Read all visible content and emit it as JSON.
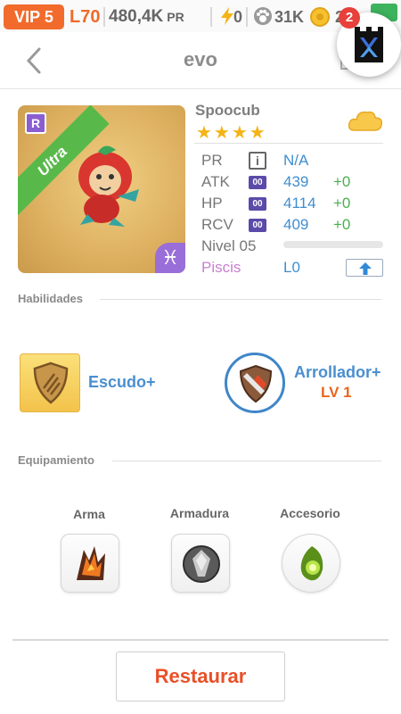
{
  "status_bar": {
    "vip": "VIP 5",
    "level": "L70",
    "pr_value": "480,4K",
    "pr_unit": "PR",
    "energy": "0",
    "paw_count": "31K",
    "coins": "2",
    "notification_count": "2",
    "icons": [
      "lightning-icon",
      "paw-icon",
      "coin-icon",
      "castle-logo-icon"
    ]
  },
  "nav": {
    "title": "evo",
    "back_icon": "chevron-left-icon"
  },
  "monster": {
    "name": "Spoocub",
    "stars": "★★★★",
    "rarity_badge": "R",
    "rarity_ribbon": "Ultra",
    "zodiac_symbol": "♓",
    "stats": [
      {
        "label": "PR",
        "value": "N/A",
        "bonus": ""
      },
      {
        "label": "ATK",
        "chip": "00",
        "value": "439",
        "bonus": "+0"
      },
      {
        "label": "HP",
        "chip": "00",
        "value": "4114",
        "bonus": "+0"
      },
      {
        "label": "RCV",
        "chip": "00",
        "value": "409",
        "bonus": "+0"
      }
    ],
    "level_label": "Nivel 05",
    "level_progress": 0,
    "sign": "Piscis",
    "sign_level": "L0"
  },
  "skills": {
    "section_title": "Habilidades",
    "items": [
      {
        "name": "Escudo+",
        "level": ""
      },
      {
        "name": "Arrollador+",
        "level": "LV 1"
      }
    ]
  },
  "equipment": {
    "section_title": "Equipamiento",
    "slots": [
      {
        "label": "Arma",
        "icon": "molten-claw-icon"
      },
      {
        "label": "Armadura",
        "icon": "crystal-armor-icon"
      },
      {
        "label": "Accesorio",
        "icon": "green-gem-icon"
      }
    ]
  },
  "actions": {
    "restore_label": "Restaurar"
  },
  "colors": {
    "accent_orange": "#f26b2c",
    "link_blue": "#3e8ed0",
    "bonus_green": "#4caf50",
    "ribbon_green": "#58b94a",
    "zodiac_purple": "#9a6ed8"
  }
}
